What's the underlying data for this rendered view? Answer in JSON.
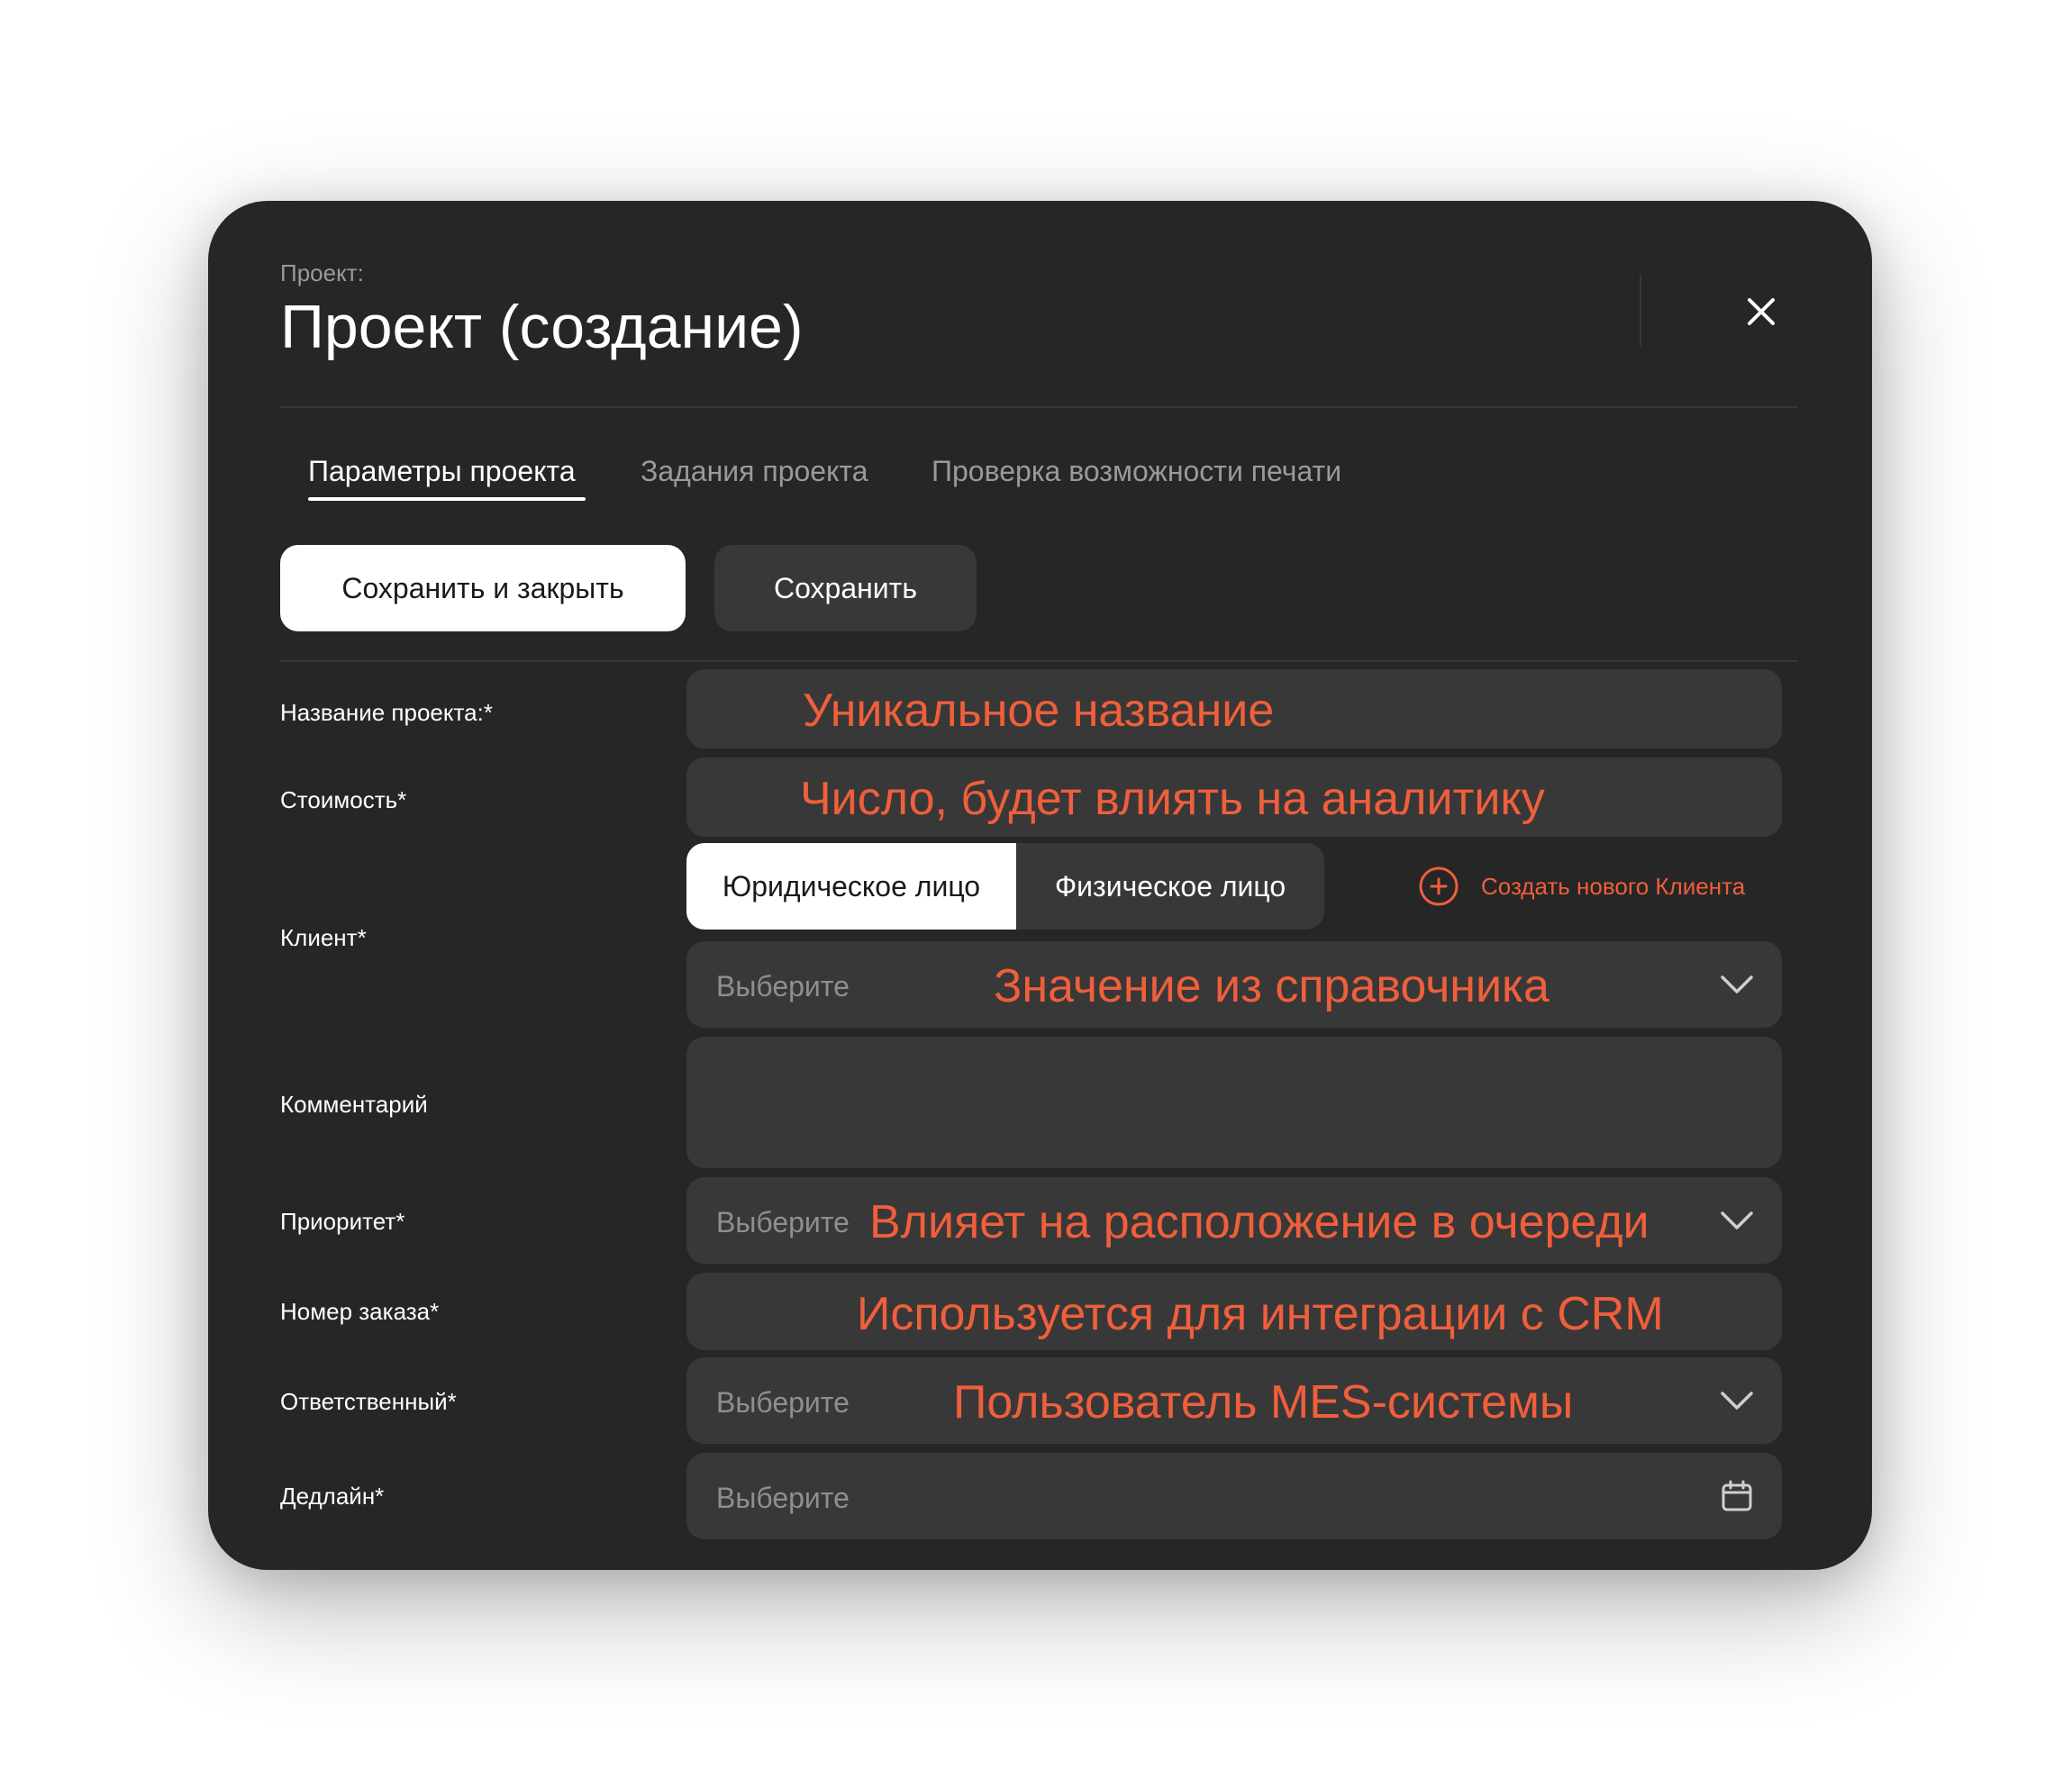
{
  "header": {
    "breadcrumb": "Проект:",
    "title": "Проект (создание)"
  },
  "tabs": [
    {
      "label": "Параметры проекта",
      "active": true
    },
    {
      "label": "Задания проекта",
      "active": false
    },
    {
      "label": "Проверка возможности печати",
      "active": false
    }
  ],
  "toolbar": {
    "save_close_label": "Сохранить и закрыть",
    "save_label": "Сохранить"
  },
  "form": {
    "project_name": {
      "label": "Название проекта:*",
      "hint": "Уникальное название"
    },
    "cost": {
      "label": "Стоимость*",
      "hint": "Число, будет влиять на аналитику"
    },
    "client": {
      "label": "Клиент*",
      "types": [
        "Юридическое лицо",
        "Физическое лицо"
      ],
      "selected_type": "Юридическое лицо",
      "create_label": "Создать нового Клиента",
      "placeholder": "Выберите",
      "hint": "Значение из справочника"
    },
    "comment": {
      "label": "Комментарий",
      "value": ""
    },
    "priority": {
      "label": "Приоритет*",
      "placeholder": "Выберите",
      "hint": "Влияет на расположение в очереди"
    },
    "order_number": {
      "label": "Номер заказа*",
      "hint": "Используется для интеграции с CRM"
    },
    "responsible": {
      "label": "Ответственный*",
      "placeholder": "Выберите",
      "hint": "Пользователь MES-системы"
    },
    "deadline": {
      "label": "Дедлайн*",
      "placeholder": "Выберите"
    }
  },
  "colors": {
    "modal_bg": "#262626",
    "field_bg": "#383838",
    "accent": "#ef5f3b",
    "primary_button_bg": "#ffffff"
  },
  "icons": [
    "close-icon",
    "plus-circle-icon",
    "chevron-down-icon",
    "calendar-icon"
  ]
}
